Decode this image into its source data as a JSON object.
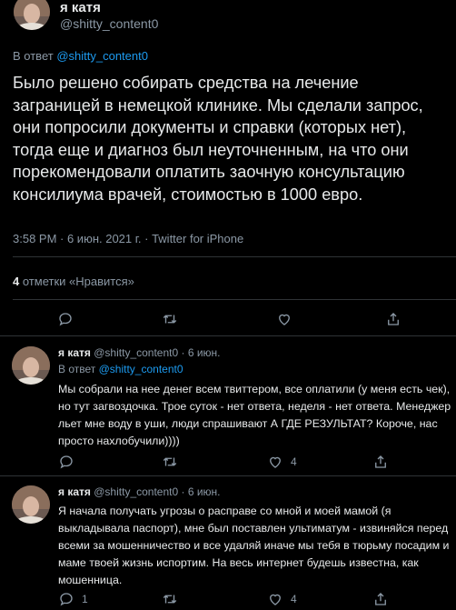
{
  "main": {
    "author_name": "я катя",
    "author_handle": "@shitty_content0",
    "reply_prefix": "В ответ",
    "reply_mention": "@shitty_content0",
    "text": "Было решено собирать средства на лечение заграницей в немецкой клинике. Мы сделали запрос, они попросили документы и справки (которых нет), тогда еще и диагноз был неуточненным, на что они порекомендовали оплатить заочную консультацию консилиума врачей, стоимостью в 1000 евро.",
    "meta": "3:58 PM · 6 июн. 2021 г. · Twitter for iPhone",
    "likes_count": "4",
    "likes_label": "отметки «Нравится»"
  },
  "replies": [
    {
      "name": "я катя",
      "handle": "@shitty_content0",
      "time": "· 6 июн.",
      "reply_prefix": "В ответ",
      "reply_mention": "@shitty_content0",
      "text": "Мы собрали на нее денег всем твиттером, все оплатили (у меня есть чек), но тут загвоздочка. Трое суток - нет ответа, неделя - нет ответа. Менеджер льет мне воду в уши, люди спрашивают А ГДЕ РЕЗУЛЬТАТ? Короче, нас просто нахлобучили))))",
      "reply_count": "",
      "like_count": "4"
    },
    {
      "name": "я катя",
      "handle": "@shitty_content0",
      "time": "· 6 июн.",
      "text": "Я начала получать угрозы о расправе со мной и моей мамой (я выкладывала паспорт), мне был поставлен ультиматум - извиняйся перед всеми за мошенничество и все удаляй иначе мы тебя в тюрьму посадим и маме твоей жизнь испортим. На весь интернет будешь известна, как мошенница.",
      "reply_count": "1",
      "like_count": "4"
    }
  ],
  "icons": [
    "reply-icon",
    "retweet-icon",
    "like-icon",
    "share-icon"
  ],
  "colors": {
    "background": "#000000",
    "text": "#e7e9ea",
    "secondary": "#8b98a5",
    "link": "#1d9bf0",
    "divider": "#2f3336"
  }
}
